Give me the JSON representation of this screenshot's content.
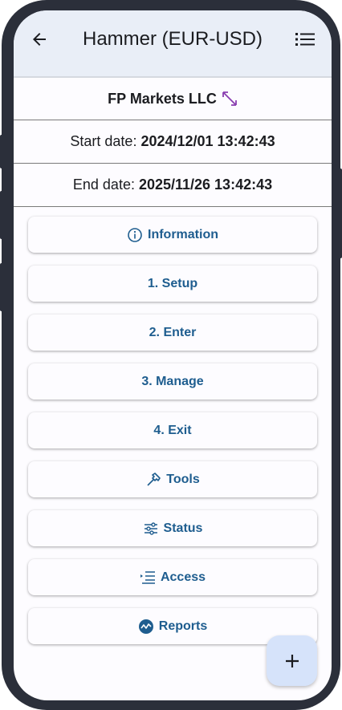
{
  "appbar": {
    "title": "Hammer (EUR-USD)"
  },
  "broker": {
    "name": "FP Markets LLC"
  },
  "dates": {
    "start_label": "Start date:",
    "start_value": "2024/12/01 13:42:43",
    "end_label": "End date:",
    "end_value": "2025/11/26 13:42:43"
  },
  "buttons": [
    {
      "label": "Information",
      "icon": "info-icon"
    },
    {
      "label": "1. Setup"
    },
    {
      "label": "2. Enter"
    },
    {
      "label": "3. Manage"
    },
    {
      "label": "4. Exit"
    },
    {
      "label": "Tools",
      "icon": "hammer-icon"
    },
    {
      "label": "Status",
      "icon": "sliders-icon"
    },
    {
      "label": "Access",
      "icon": "list-indent-icon"
    },
    {
      "label": "Reports",
      "icon": "chart-circle-icon"
    }
  ],
  "colors": {
    "accent": "#1e5d8f",
    "appbar": "#e9eef7",
    "fab": "#d6e3fa",
    "expand": "#8a3fb0"
  }
}
